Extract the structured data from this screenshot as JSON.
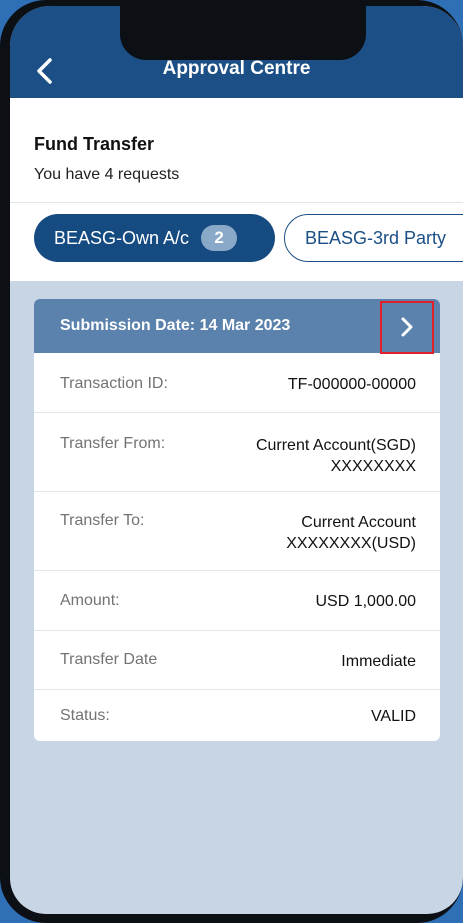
{
  "nav": {
    "title": "Approval Centre",
    "back_icon": "chevron-left-icon"
  },
  "header": {
    "title": "Fund Transfer",
    "subtitle": "You have 4 requests"
  },
  "tabs": [
    {
      "label": "BEASG-Own A/c",
      "badge": "2",
      "active": true
    },
    {
      "label": "BEASG-3rd Party",
      "active": false
    }
  ],
  "card": {
    "submission_label": "Submission Date: 14 Mar 2023",
    "chevron_icon": "chevron-right-icon",
    "rows": [
      {
        "label": "Transaction ID:",
        "value": [
          "TF-000000-00000"
        ]
      },
      {
        "label": "Transfer From:",
        "value": [
          "Current Account(SGD)",
          "XXXXXXXX"
        ]
      },
      {
        "label": "Transfer To:",
        "value": [
          "Current Account",
          "XXXXXXXX(USD)"
        ]
      },
      {
        "label": "Amount:",
        "value": [
          "USD 1,000.00"
        ]
      },
      {
        "label": "Transfer Date",
        "value": [
          "Immediate"
        ]
      },
      {
        "label": "Status:",
        "value": [
          "VALID"
        ]
      }
    ]
  },
  "colors": {
    "nav_bg": "#1b4f86",
    "card_header_bg": "#5b81ad",
    "screen_bg": "#c7d5e5",
    "highlight_box": "#e0202a"
  }
}
